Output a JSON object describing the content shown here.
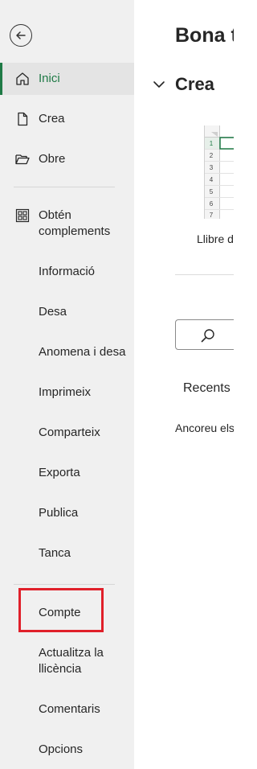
{
  "sidebar": {
    "items": [
      {
        "label": "Inici",
        "icon": "home-icon",
        "active": true
      },
      {
        "label": "Crea",
        "icon": "new-document-icon"
      },
      {
        "label": "Obre",
        "icon": "folder-open-icon"
      },
      {
        "label": "Obtén complements",
        "icon": "add-ins-grid-icon"
      },
      {
        "label": "Informació"
      },
      {
        "label": "Desa"
      },
      {
        "label": "Anomena i desa"
      },
      {
        "label": "Imprimeix"
      },
      {
        "label": "Comparteix"
      },
      {
        "label": "Exporta"
      },
      {
        "label": "Publica"
      },
      {
        "label": "Tanca"
      },
      {
        "label": "Compte",
        "highlighted": true
      },
      {
        "label": "Actualitza la llicència"
      },
      {
        "label": "Comentaris"
      },
      {
        "label": "Opcions"
      }
    ],
    "accent_color": "#1f7a46",
    "highlight_color": "#e0202a"
  },
  "main": {
    "greeting": "Bona t",
    "new_section_title": "Crea",
    "template_caption": "Llibre d",
    "spreadsheet_row_numbers": [
      "1",
      "2",
      "3",
      "4",
      "5",
      "6",
      "7"
    ],
    "recents_label": "Recents",
    "pin_message": "Ancoreu els fitxer."
  }
}
